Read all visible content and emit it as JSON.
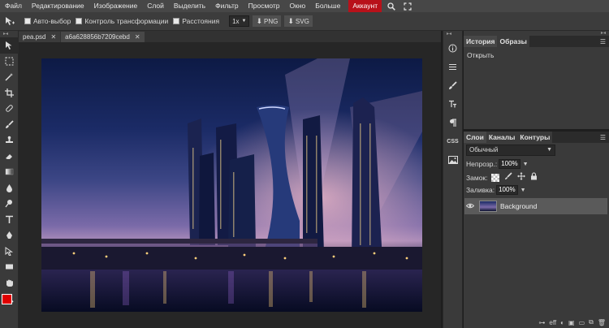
{
  "menu": {
    "items": [
      "Файл",
      "Редактирование",
      "Изображение",
      "Слой",
      "Выделить",
      "Фильтр",
      "Просмотр",
      "Окно",
      "Больше"
    ],
    "account_label": "Аккаунт",
    "icons": [
      "search-icon",
      "fullscreen-icon"
    ]
  },
  "options": {
    "auto_select": "Авто-выбор",
    "transform_controls": "Контроль трансформации",
    "distances": "Расстояния",
    "scale": "1x",
    "png_label": "PNG",
    "svg_label": "SVG"
  },
  "tabs": [
    {
      "label": "pea.psd",
      "active": false
    },
    {
      "label": "a6a628856b7209cebd",
      "active": true
    }
  ],
  "history_panel": {
    "tabs": [
      "История",
      "Образы"
    ],
    "items": [
      "Открыть"
    ]
  },
  "layers_panel": {
    "tabs": [
      "Слои",
      "Каналы",
      "Контуры"
    ],
    "blend_mode": "Обычный",
    "opacity_label": "Непрозр.:",
    "opacity_value": "100%",
    "lock_label": "Замок:",
    "fill_label": "Заливка:",
    "fill_value": "100%",
    "layers": [
      {
        "name": "Background",
        "visible": true
      }
    ],
    "footer_label": "eff"
  },
  "colors": {
    "foreground": "#e00000",
    "background": "#000000",
    "account_accent": "#b8111a"
  }
}
